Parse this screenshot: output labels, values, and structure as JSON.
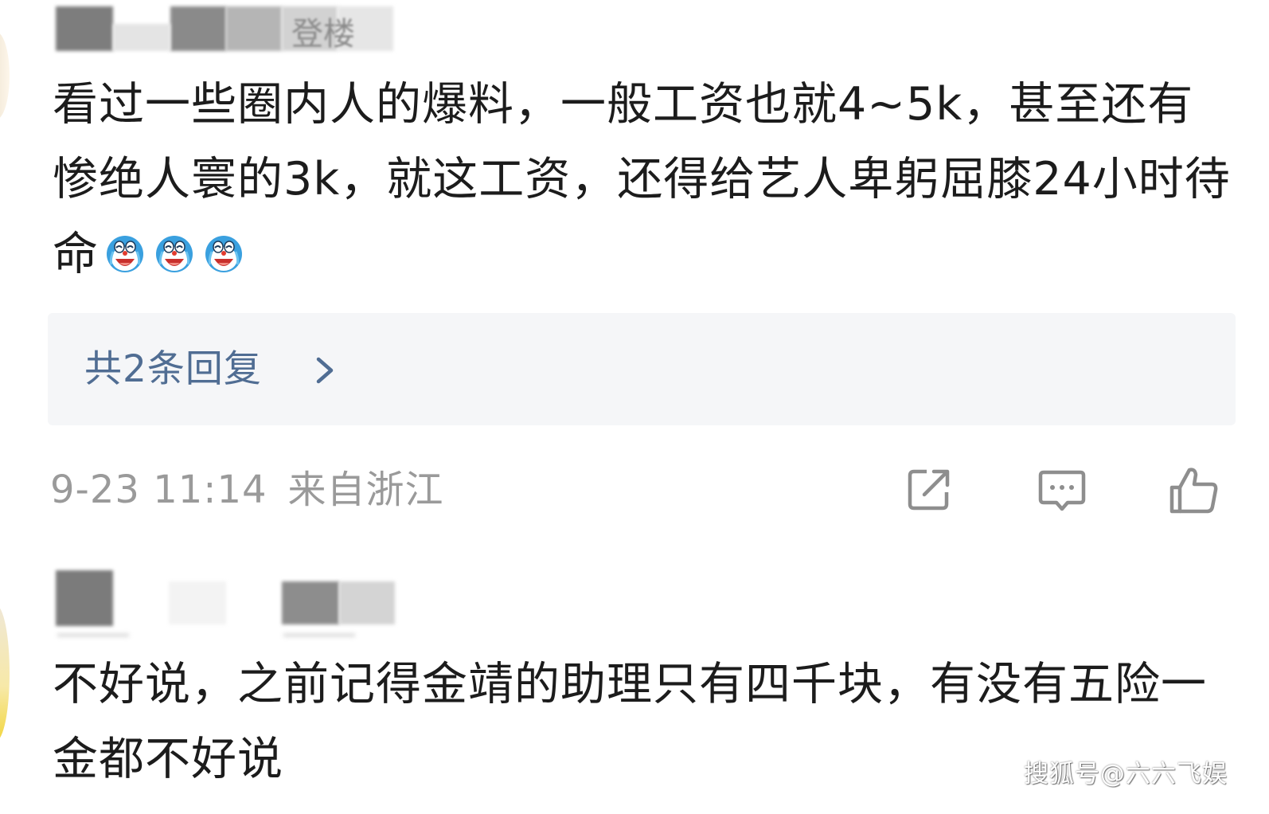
{
  "comments": [
    {
      "username_partial": "登楼",
      "text": "看过一些圈内人的爆料，一般工资也就4~5k，甚至还有惨绝人寰的3k，就这工资，还得给艺人卑躬屈膝24小时待命",
      "emojis": [
        "doraemon-laugh-cry-icon",
        "doraemon-laugh-cry-icon",
        "doraemon-laugh-cry-icon"
      ],
      "replies_link": "共2条回复",
      "date": "9-23 11:14",
      "location": "来自浙江",
      "actions": [
        "share-icon",
        "comment-icon",
        "thumbs-up-icon"
      ]
    },
    {
      "text": "不好说，之前记得金靖的助理只有四千块，有没有五险一金都不好说"
    }
  ],
  "watermark": "搜狐号@六六飞娱",
  "colors": {
    "link": "#506d93",
    "meta": "#9a9a9a",
    "reply_bg": "#f5f6f8",
    "text": "#1c1c1c"
  }
}
